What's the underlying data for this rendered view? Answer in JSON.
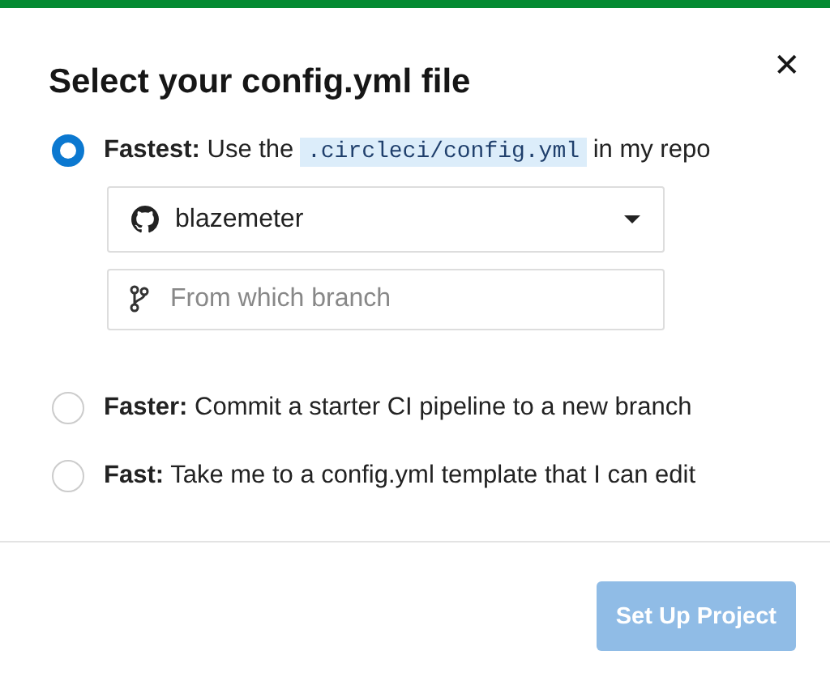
{
  "dialog": {
    "title": "Select your config.yml file",
    "close_label": "✕"
  },
  "options": [
    {
      "lead": "Fastest:",
      "text": "Use the",
      "code": ".circleci/config.yml",
      "text_after": "in my repo",
      "selected": true
    },
    {
      "lead": "Faster:",
      "text": "Commit a starter CI pipeline to a new branch",
      "selected": false
    },
    {
      "lead": "Fast:",
      "text": "Take me to a config.yml template that I can edit",
      "selected": false
    }
  ],
  "org_select": {
    "value": "blazemeter"
  },
  "branch_field": {
    "placeholder": "From which branch"
  },
  "button": {
    "label": "Set Up Project",
    "disabled": true
  }
}
